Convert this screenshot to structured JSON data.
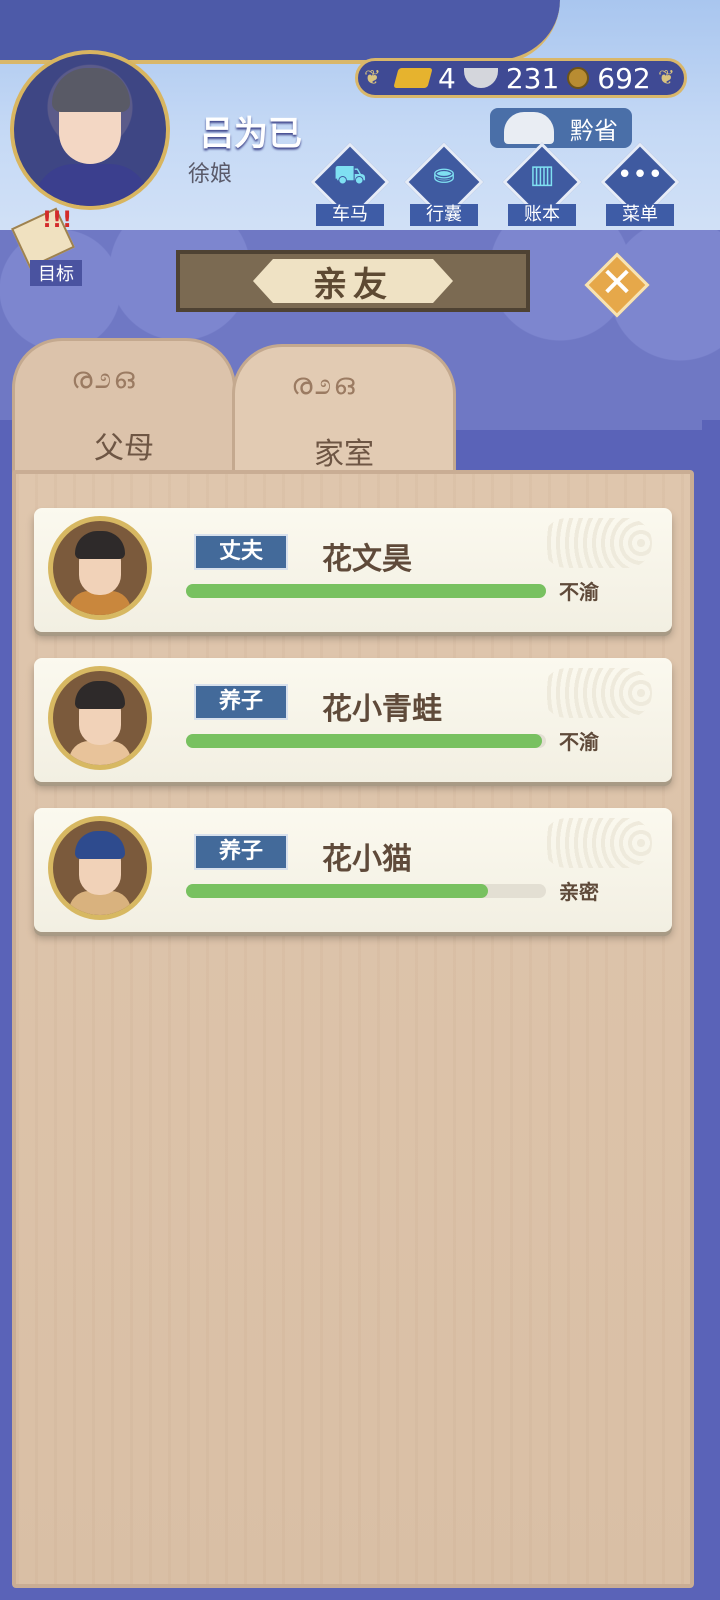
{
  "player": {
    "name": "吕为已",
    "title": "徐娘"
  },
  "currency": {
    "gold": "4",
    "silver": "231",
    "coins": "692"
  },
  "location": "黔省",
  "menu": [
    {
      "label": "车马",
      "icon": "carriage-icon"
    },
    {
      "label": "行囊",
      "icon": "bag-icon"
    },
    {
      "label": "账本",
      "icon": "ledger-icon"
    },
    {
      "label": "菜单",
      "icon": "more-icon"
    }
  ],
  "goal_label": "目标",
  "page_title": "亲友",
  "tabs": [
    {
      "label": "父母",
      "active": false
    },
    {
      "label": "家室",
      "active": true
    }
  ],
  "relations": [
    {
      "role": "丈夫",
      "name": "花文昊",
      "status": "不渝",
      "affinity": 1.0
    },
    {
      "role": "养子",
      "name": "花小青蛙",
      "status": "不渝",
      "affinity": 0.99
    },
    {
      "role": "养子",
      "name": "花小猫",
      "status": "亲密",
      "affinity": 0.84
    }
  ],
  "colors": {
    "bar_fill": "#78c160",
    "badge_bg": "#436a9a",
    "header_blue": "#4d5aa8"
  }
}
